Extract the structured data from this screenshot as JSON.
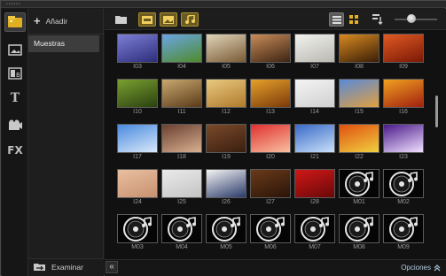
{
  "sidebar": {
    "add_label": "Añadir",
    "library_items": [
      {
        "label": "Muestras"
      }
    ],
    "browse_label": "Examinar",
    "tools": [
      "video-media-icon",
      "instant-project-icon",
      "transition-icon",
      "title-icon",
      "graphic-icon",
      "filter-icon"
    ],
    "title_tool_glyph": "T",
    "fx_tool_glyph": "FX",
    "collapse_glyph": "«"
  },
  "toolbar": {
    "filters": [
      "show-videos-icon",
      "show-photos-icon",
      "show-audio-icon"
    ],
    "views": [
      "list-view-icon",
      "thumbnail-view-icon"
    ],
    "zoom_level": 0.3
  },
  "thumbnails": [
    {
      "label": "I03",
      "kind": "image",
      "colors": [
        "#7d7fd6",
        "#2c2d7a"
      ]
    },
    {
      "label": "I04",
      "kind": "image",
      "colors": [
        "#6aa6e6",
        "#4f8a2a"
      ]
    },
    {
      "label": "I05",
      "kind": "image",
      "colors": [
        "#e0d5b8",
        "#7a5a36"
      ]
    },
    {
      "label": "I06",
      "kind": "image",
      "colors": [
        "#c88c58",
        "#3d2414"
      ]
    },
    {
      "label": "I07",
      "kind": "image",
      "colors": [
        "#f2f2ee",
        "#b9b9b0"
      ]
    },
    {
      "label": "I08",
      "kind": "image",
      "colors": [
        "#d88a22",
        "#3a1e06"
      ]
    },
    {
      "label": "I09",
      "kind": "image",
      "colors": [
        "#e05a22",
        "#7a1806"
      ]
    },
    {
      "label": "I10",
      "kind": "image",
      "colors": [
        "#7aa030",
        "#2a4010"
      ]
    },
    {
      "label": "I11",
      "kind": "image",
      "colors": [
        "#c9a870",
        "#5a3a18"
      ]
    },
    {
      "label": "I12",
      "kind": "image",
      "colors": [
        "#e8c980",
        "#b07a2c"
      ]
    },
    {
      "label": "I13",
      "kind": "image",
      "colors": [
        "#e6a02a",
        "#7a3a0a"
      ]
    },
    {
      "label": "I14",
      "kind": "image",
      "colors": [
        "#f4f4f4",
        "#d0d0d0"
      ]
    },
    {
      "label": "I15",
      "kind": "image",
      "colors": [
        "#5a8ad8",
        "#e0a040"
      ]
    },
    {
      "label": "I16",
      "kind": "image",
      "colors": [
        "#f0a020",
        "#a02010"
      ]
    },
    {
      "label": "I17",
      "kind": "image",
      "colors": [
        "#4a8ae0",
        "#d8e8f8"
      ]
    },
    {
      "label": "I18",
      "kind": "image",
      "colors": [
        "#6a4030",
        "#d8b090"
      ]
    },
    {
      "label": "I19",
      "kind": "image",
      "colors": [
        "#7a4a2a",
        "#3a1e10"
      ]
    },
    {
      "label": "I20",
      "kind": "image",
      "colors": [
        "#e03030",
        "#f8c0a0"
      ]
    },
    {
      "label": "I21",
      "kind": "image",
      "colors": [
        "#3a6ac8",
        "#c8e0f8"
      ]
    },
    {
      "label": "I22",
      "kind": "image",
      "colors": [
        "#e05010",
        "#f0d040"
      ]
    },
    {
      "label": "I23",
      "kind": "image",
      "colors": [
        "#4a1a8a",
        "#f0e0ff"
      ]
    },
    {
      "label": "I24",
      "kind": "image",
      "colors": [
        "#e8c0a0",
        "#c89070"
      ]
    },
    {
      "label": "I25",
      "kind": "image",
      "colors": [
        "#eaeaea",
        "#c4c4c4"
      ]
    },
    {
      "label": "I26",
      "kind": "image",
      "colors": [
        "#f4f4f4",
        "#2a3a6a"
      ]
    },
    {
      "label": "I27",
      "kind": "image",
      "colors": [
        "#6a3a1a",
        "#2a1408"
      ]
    },
    {
      "label": "I28",
      "kind": "image",
      "colors": [
        "#d01818",
        "#6a0808"
      ]
    },
    {
      "label": "M01",
      "kind": "audio",
      "colors": [
        "#0a0a0a",
        "#d8d8d8"
      ]
    },
    {
      "label": "M02",
      "kind": "audio",
      "colors": [
        "#0a0a0a",
        "#d8d8d8"
      ]
    },
    {
      "label": "M03",
      "kind": "audio",
      "colors": [
        "#0a0a0a",
        "#d8d8d8"
      ]
    },
    {
      "label": "M04",
      "kind": "audio",
      "colors": [
        "#0a0a0a",
        "#d8d8d8"
      ]
    },
    {
      "label": "M05",
      "kind": "audio",
      "colors": [
        "#0a0a0a",
        "#d8d8d8"
      ]
    },
    {
      "label": "M06",
      "kind": "audio",
      "colors": [
        "#0a0a0a",
        "#d8d8d8"
      ]
    },
    {
      "label": "M07",
      "kind": "audio",
      "colors": [
        "#0a0a0a",
        "#d8d8d8"
      ]
    },
    {
      "label": "M08",
      "kind": "audio",
      "colors": [
        "#0a0a0a",
        "#d8d8d8"
      ]
    },
    {
      "label": "M09",
      "kind": "audio",
      "colors": [
        "#0a0a0a",
        "#d8d8d8"
      ]
    }
  ],
  "footer": {
    "options_label": "Opciones",
    "options_icon": "double-chevron-up-icon"
  },
  "colors": {
    "accent": "#a8902e",
    "panel": "#1b1b1b",
    "selected": "#3d3d3d"
  }
}
